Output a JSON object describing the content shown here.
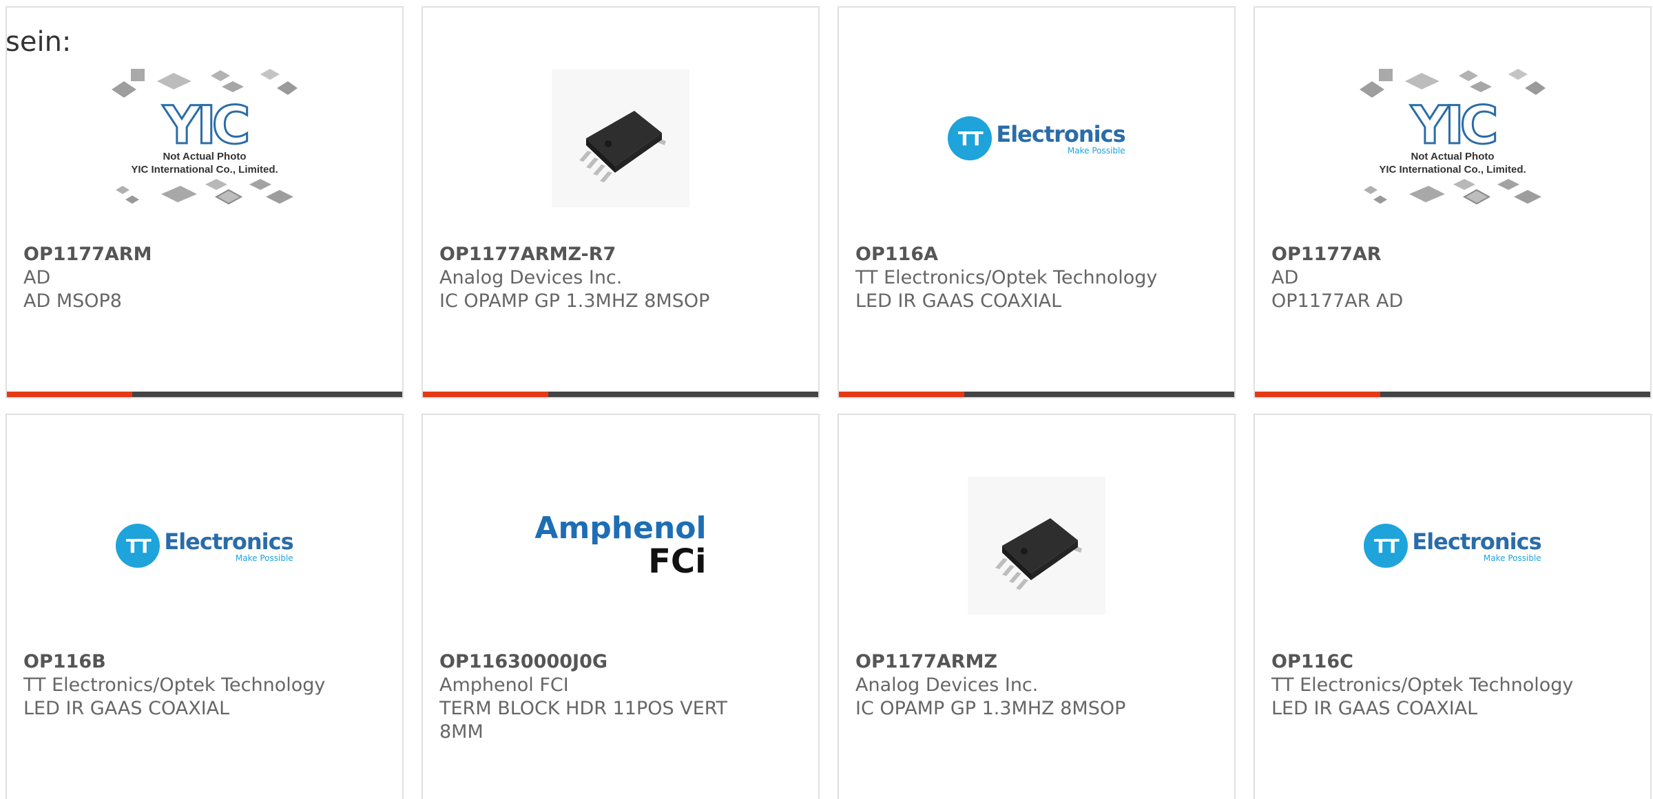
{
  "intro_text": "sein:",
  "placeholder_caption_line1": "Not Actual Photo",
  "placeholder_caption_line2": "YIC International Co., Limited.",
  "placeholder_logo_text": "YIC",
  "tt_logo": {
    "circle": "TT",
    "main": "Electronics",
    "tagline": "Make Possible"
  },
  "amphenol_logo": {
    "main": "Amphenol",
    "sub": "FCi"
  },
  "accent_color": "#e53916",
  "bar_color": "#444444",
  "products": [
    {
      "part": "OP1177ARM",
      "manufacturer": "AD",
      "description": "AD MSOP8",
      "image": "yic-placeholder"
    },
    {
      "part": "OP1177ARMZ-R7",
      "manufacturer": "Analog Devices Inc.",
      "description": "IC OPAMP GP 1.3MHZ 8MSOP",
      "image": "msop-chip"
    },
    {
      "part": "OP116A",
      "manufacturer": "TT Electronics/Optek Technology",
      "description": "LED IR GAAS COAXIAL",
      "image": "tt-electronics-logo"
    },
    {
      "part": "OP1177AR",
      "manufacturer": "AD",
      "description": "OP1177AR AD",
      "image": "yic-placeholder"
    },
    {
      "part": "OP116B",
      "manufacturer": "TT Electronics/Optek Technology",
      "description": "LED IR GAAS COAXIAL",
      "image": "tt-electronics-logo"
    },
    {
      "part": "OP11630000J0G",
      "manufacturer": "Amphenol FCI",
      "description": "TERM BLOCK HDR 11POS VERT 8MM",
      "image": "amphenol-fci-logo"
    },
    {
      "part": "OP1177ARMZ",
      "manufacturer": "Analog Devices Inc.",
      "description": "IC OPAMP GP 1.3MHZ 8MSOP",
      "image": "msop-chip"
    },
    {
      "part": "OP116C",
      "manufacturer": "TT Electronics/Optek Technology",
      "description": "LED IR GAAS COAXIAL",
      "image": "tt-electronics-logo"
    }
  ]
}
